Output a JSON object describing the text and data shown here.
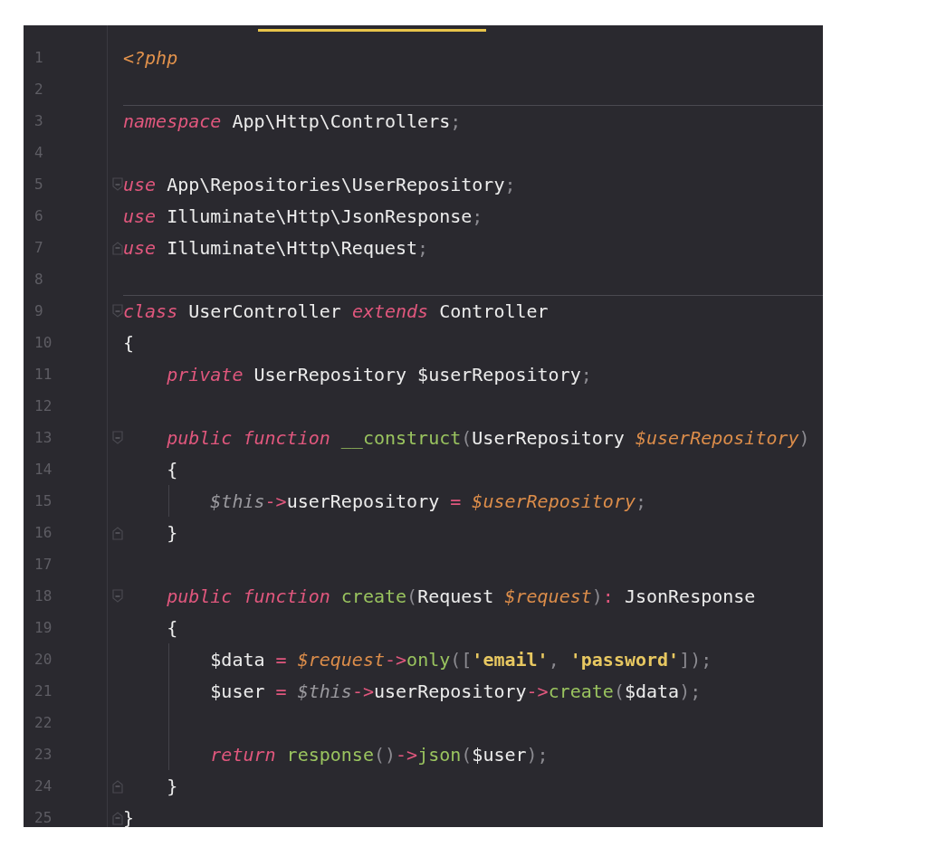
{
  "editor": {
    "lines": [
      {
        "number": "1",
        "tokens": [
          {
            "kind": "tag",
            "text": "<?php"
          }
        ]
      },
      {
        "number": "2"
      },
      {
        "number": "3",
        "separator_above": true,
        "tokens": [
          {
            "kind": "keyword",
            "text": "namespace"
          },
          {
            "kind": "plain",
            "text": " App\\Http\\Controllers"
          },
          {
            "kind": "punct",
            "text": ";"
          }
        ]
      },
      {
        "number": "4"
      },
      {
        "number": "5",
        "fold_start": true,
        "tokens": [
          {
            "kind": "keyword",
            "text": "use"
          },
          {
            "kind": "plain",
            "text": " App\\Repositories\\UserRepository"
          },
          {
            "kind": "punct",
            "text": ";"
          }
        ]
      },
      {
        "number": "6",
        "tokens": [
          {
            "kind": "keyword",
            "text": "use"
          },
          {
            "kind": "plain",
            "text": " Illuminate\\Http\\JsonResponse"
          },
          {
            "kind": "punct",
            "text": ";"
          }
        ]
      },
      {
        "number": "7",
        "fold_end": true,
        "tokens": [
          {
            "kind": "keyword",
            "text": "use"
          },
          {
            "kind": "plain",
            "text": " Illuminate\\Http\\Request"
          },
          {
            "kind": "punct",
            "text": ";"
          }
        ]
      },
      {
        "number": "8"
      },
      {
        "number": "9",
        "separator_above": true,
        "fold_start": true,
        "tokens": [
          {
            "kind": "keyword",
            "text": "class"
          },
          {
            "kind": "plain",
            "text": " UserController "
          },
          {
            "kind": "keyword",
            "text": "extends"
          },
          {
            "kind": "plain",
            "text": " Controller"
          }
        ]
      },
      {
        "number": "10",
        "tokens": [
          {
            "kind": "plain",
            "text": "{"
          }
        ]
      },
      {
        "number": "11",
        "tokens": [
          {
            "kind": "keyword",
            "text": "    private"
          },
          {
            "kind": "plain",
            "text": " UserRepository $userRepository"
          },
          {
            "kind": "punct",
            "text": ";"
          }
        ]
      },
      {
        "number": "12"
      },
      {
        "number": "13",
        "fold_start": true,
        "tokens": [
          {
            "kind": "keyword",
            "text": "    public function"
          },
          {
            "kind": "function",
            "text": " __construct"
          },
          {
            "kind": "punct",
            "text": "("
          },
          {
            "kind": "plain",
            "text": "UserRepository "
          },
          {
            "kind": "variable",
            "text": "$userRepository"
          },
          {
            "kind": "punct",
            "text": ")"
          }
        ]
      },
      {
        "number": "14",
        "tokens": [
          {
            "kind": "plain",
            "text": "    {"
          }
        ]
      },
      {
        "number": "15",
        "indent_guide": true,
        "tokens": [
          {
            "kind": "this",
            "text": "        $this"
          },
          {
            "kind": "operator",
            "text": "->"
          },
          {
            "kind": "plain",
            "text": "userRepository "
          },
          {
            "kind": "operator",
            "text": "="
          },
          {
            "kind": "variable",
            "text": " $userRepository"
          },
          {
            "kind": "punct",
            "text": ";"
          }
        ]
      },
      {
        "number": "16",
        "fold_end": true,
        "tokens": [
          {
            "kind": "plain",
            "text": "    }"
          }
        ]
      },
      {
        "number": "17"
      },
      {
        "number": "18",
        "fold_start": true,
        "tokens": [
          {
            "kind": "keyword",
            "text": "    public function"
          },
          {
            "kind": "function",
            "text": " create"
          },
          {
            "kind": "punct",
            "text": "("
          },
          {
            "kind": "plain",
            "text": "Request "
          },
          {
            "kind": "variable",
            "text": "$request"
          },
          {
            "kind": "punct",
            "text": ")"
          },
          {
            "kind": "operator",
            "text": ":"
          },
          {
            "kind": "plain",
            "text": " JsonResponse"
          }
        ]
      },
      {
        "number": "19",
        "tokens": [
          {
            "kind": "plain",
            "text": "    {"
          }
        ]
      },
      {
        "number": "20",
        "indent_guide": true,
        "tokens": [
          {
            "kind": "plain",
            "text": "        $data "
          },
          {
            "kind": "operator",
            "text": "="
          },
          {
            "kind": "variable",
            "text": " $request"
          },
          {
            "kind": "operator",
            "text": "->"
          },
          {
            "kind": "function",
            "text": "only"
          },
          {
            "kind": "punct",
            "text": "(["
          },
          {
            "kind": "string",
            "text": "'email'"
          },
          {
            "kind": "punct",
            "text": ", "
          },
          {
            "kind": "string",
            "text": "'password'"
          },
          {
            "kind": "punct",
            "text": "]);"
          }
        ]
      },
      {
        "number": "21",
        "indent_guide": true,
        "tokens": [
          {
            "kind": "plain",
            "text": "        $user "
          },
          {
            "kind": "operator",
            "text": "="
          },
          {
            "kind": "this",
            "text": " $this"
          },
          {
            "kind": "operator",
            "text": "->"
          },
          {
            "kind": "plain",
            "text": "userRepository"
          },
          {
            "kind": "operator",
            "text": "->"
          },
          {
            "kind": "function",
            "text": "create"
          },
          {
            "kind": "punct",
            "text": "("
          },
          {
            "kind": "plain",
            "text": "$data"
          },
          {
            "kind": "punct",
            "text": ");"
          }
        ]
      },
      {
        "number": "22",
        "indent_guide": true
      },
      {
        "number": "23",
        "indent_guide": true,
        "tokens": [
          {
            "kind": "keyword",
            "text": "        return"
          },
          {
            "kind": "function",
            "text": " response"
          },
          {
            "kind": "punct",
            "text": "()"
          },
          {
            "kind": "operator",
            "text": "->"
          },
          {
            "kind": "function",
            "text": "json"
          },
          {
            "kind": "punct",
            "text": "("
          },
          {
            "kind": "plain",
            "text": "$user"
          },
          {
            "kind": "punct",
            "text": ");"
          }
        ]
      },
      {
        "number": "24",
        "fold_end": true,
        "tokens": [
          {
            "kind": "plain",
            "text": "    }"
          }
        ]
      },
      {
        "number": "25",
        "fold_end": true,
        "tokens": [
          {
            "kind": "plain",
            "text": "}"
          }
        ]
      }
    ]
  }
}
